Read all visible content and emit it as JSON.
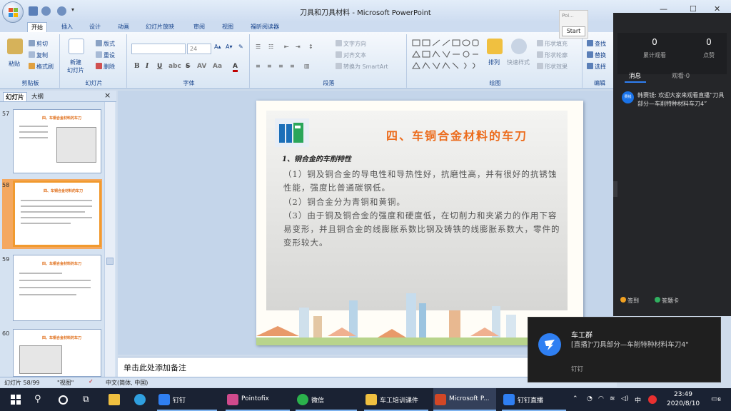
{
  "window": {
    "title": "刀具和刀具材料 - Microsoft PowerPoint"
  },
  "tabs": [
    "开始",
    "插入",
    "设计",
    "动画",
    "幻灯片放映",
    "审阅",
    "视图",
    "福昕阅读器"
  ],
  "ribbon": {
    "clipboard": {
      "paste": "粘贴",
      "cut": "剪切",
      "copy": "复制",
      "format_painter": "格式刷",
      "label": "剪贴板"
    },
    "slides": {
      "new_slide_line1": "新建",
      "new_slide_line2": "幻灯片",
      "layout": "版式",
      "reset": "重设",
      "delete": "删除",
      "label": "幻灯片"
    },
    "font": {
      "size": "24",
      "label": "字体"
    },
    "paragraph": {
      "text_direction": "文字方向",
      "align_text": "对齐文本",
      "convert_smartart": "转换为 SmartArt",
      "label": "段落"
    },
    "drawing": {
      "arrange": "排列",
      "quick_styles": "快速样式",
      "shape_fill": "形状填充",
      "shape_outline": "形状轮廓",
      "shape_effects": "形状效果",
      "label": "绘图"
    },
    "editing": {
      "find": "查找",
      "replace": "替换",
      "select": "选择",
      "label": "编辑"
    }
  },
  "pane": {
    "tab_slides": "幻灯片",
    "tab_outline": "大纲",
    "close": "×"
  },
  "thumbnails": [
    {
      "num": "57",
      "title": "四、车铜合金材料的车刀"
    },
    {
      "num": "58",
      "title": "四、车铜合金材料的车刀"
    },
    {
      "num": "59",
      "title": "四、车铜合金材料的车刀"
    },
    {
      "num": "60",
      "title": "四、车铜合金材料的车刀"
    }
  ],
  "slide": {
    "title": "四、车铜合金材料的车刀",
    "subtitle": "1、铜合金的车削特性",
    "paragraphs": [
      "（1）铜及铜合金的导电性和导热性好，抗磨性高，并有很好的抗锈蚀性能，强度比普通碳钢低。",
      "（2）铜合金分为青铜和黄铜。",
      "（3）由于铜及铜合金的强度和硬度低，在切削力和夹紧力的作用下容易变形，并且铜合金的线膨胀系数比钢及铸铁的线膨胀系数大，零件的变形较大。"
    ]
  },
  "notes": "单击此处添加备注",
  "statusbar": {
    "slide_count": "幻灯片 58/99",
    "theme": "\"视图\"",
    "language": "中文(简体, 中国)"
  },
  "popup": {
    "title": "Poi...",
    "start": "Start"
  },
  "live_panel": {
    "total_views": "0",
    "total_views_label": "累计观看",
    "likes": "0",
    "likes_label": "点赞",
    "tab_messages": "消息",
    "tab_viewers": "观看·0",
    "message": {
      "avatar": "赛钱",
      "text": "韩赛钱: 欢迎大家来观看直播“刀具部分—车削特种材料车刀4”"
    },
    "signin": "签到",
    "answer_card": "答题卡"
  },
  "toast": {
    "title": "车工群",
    "body": "[直播]\"刀具部分—车削特种材料车刀4\"",
    "app": "钉钉"
  },
  "taskbar": {
    "items": [
      {
        "label": "钉钉",
        "color": "#2f7ff2"
      },
      {
        "label": "Pointofix",
        "color": "#d04a8c"
      },
      {
        "label": "微信",
        "color": "#2bb24c"
      },
      {
        "label": "车工培训课件",
        "color": "#f0c040"
      },
      {
        "label": "Microsoft P...",
        "color": "#d24726"
      },
      {
        "label": "钉钉直播",
        "color": "#2f7ff2"
      }
    ],
    "ime": "中",
    "time": "23:49",
    "date": "2020/8/10",
    "notifications": "8"
  }
}
